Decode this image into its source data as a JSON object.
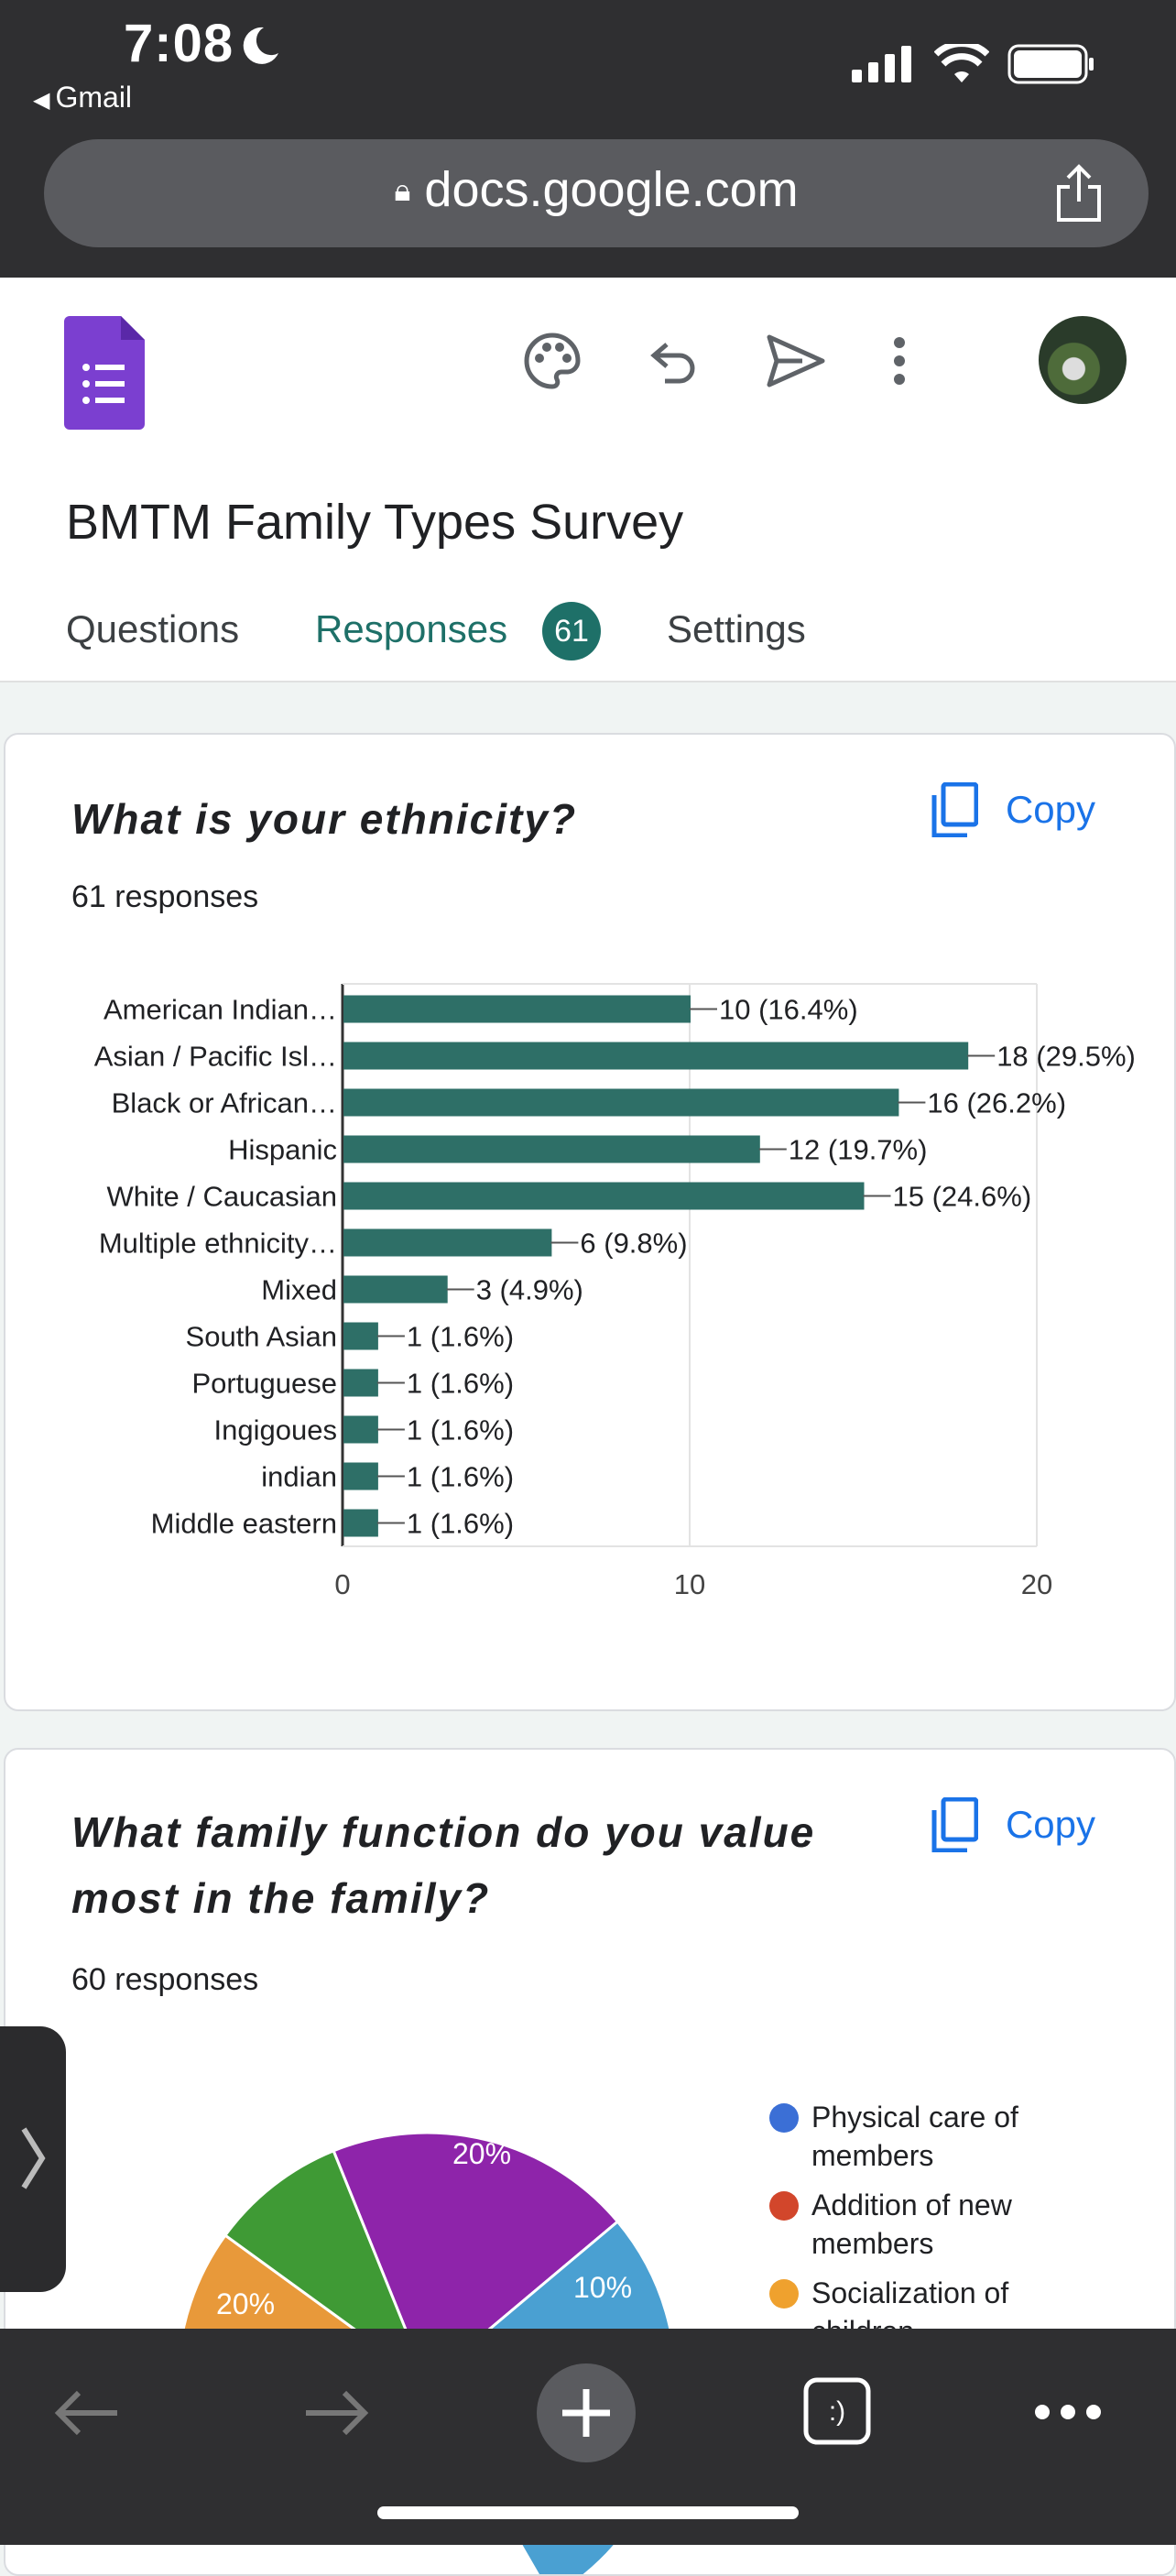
{
  "status_bar": {
    "time": "7:08",
    "back_app": "Gmail"
  },
  "browser": {
    "url": "docs.google.com"
  },
  "form": {
    "title": "BMTM Family Types Survey",
    "tabs": {
      "questions": "Questions",
      "responses": "Responses",
      "responses_count": "61",
      "settings": "Settings"
    }
  },
  "card1": {
    "question": "What is your ethnicity?",
    "responses": "61 responses",
    "copy_label": "Copy"
  },
  "card2": {
    "question_line1": "What family function do you value",
    "question_line2": "most in the family?",
    "responses": "60 responses",
    "copy_label": "Copy",
    "legend": [
      {
        "label_line1": "Physical care of",
        "label_line2": "members",
        "color": "#3b6fd6"
      },
      {
        "label_line1": "Addition of new",
        "label_line2": "members",
        "color": "#d2462b"
      },
      {
        "label_line1": "Socialization of",
        "label_line2": "children",
        "color": "#efa12e"
      }
    ]
  },
  "chart_data": [
    {
      "type": "bar",
      "orientation": "horizontal",
      "categories": [
        "American Indian…",
        "Asian / Pacific Isl…",
        "Black or African…",
        "Hispanic",
        "White / Caucasian",
        "Multiple ethnicity…",
        "Mixed",
        "South Asian",
        "Portuguese",
        "Ingigoues",
        "indian",
        "Middle eastern"
      ],
      "values": [
        10,
        18,
        16,
        12,
        15,
        6,
        3,
        1,
        1,
        1,
        1,
        1
      ],
      "data_labels": [
        "10 (16.4%)",
        "18 (29.5%)",
        "16 (26.2%)",
        "12 (19.7%)",
        "15 (24.6%)",
        "6 (9.8%)",
        "3 (4.9%)",
        "1 (1.6%)",
        "1 (1.6%)",
        "1 (1.6%)",
        "1 (1.6%)",
        "1 (1.6%)"
      ],
      "xlim": [
        0,
        20
      ],
      "xticks": [
        "0",
        "10",
        "20"
      ],
      "color": "#2e6f67",
      "grid": true
    },
    {
      "type": "pie",
      "visible_slices": [
        {
          "label": "20%",
          "value": 20,
          "color": "#8e24aa"
        },
        {
          "label": "10%",
          "value": 10,
          "color": "#4aa0d2"
        },
        {
          "label": "20%",
          "value": 20,
          "color": "#e8993a"
        },
        {
          "label": "",
          "value": 7,
          "color": "#3f9a35"
        }
      ]
    }
  ]
}
